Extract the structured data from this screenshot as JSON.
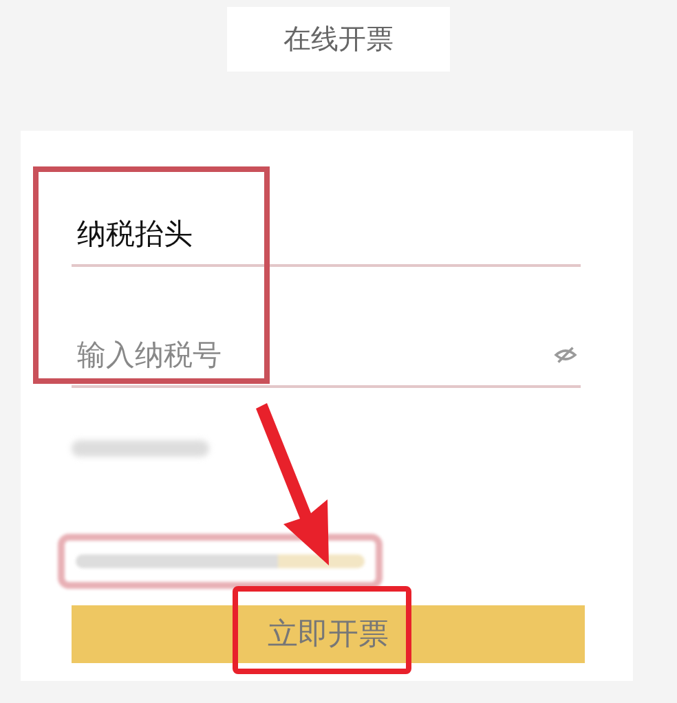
{
  "header": {
    "title": "在线开票"
  },
  "form": {
    "fields": [
      {
        "kind": "text",
        "value": "纳税抬头"
      },
      {
        "kind": "secret",
        "placeholder": "输入纳税号"
      }
    ]
  },
  "submit_button": {
    "label": "立即开票"
  }
}
